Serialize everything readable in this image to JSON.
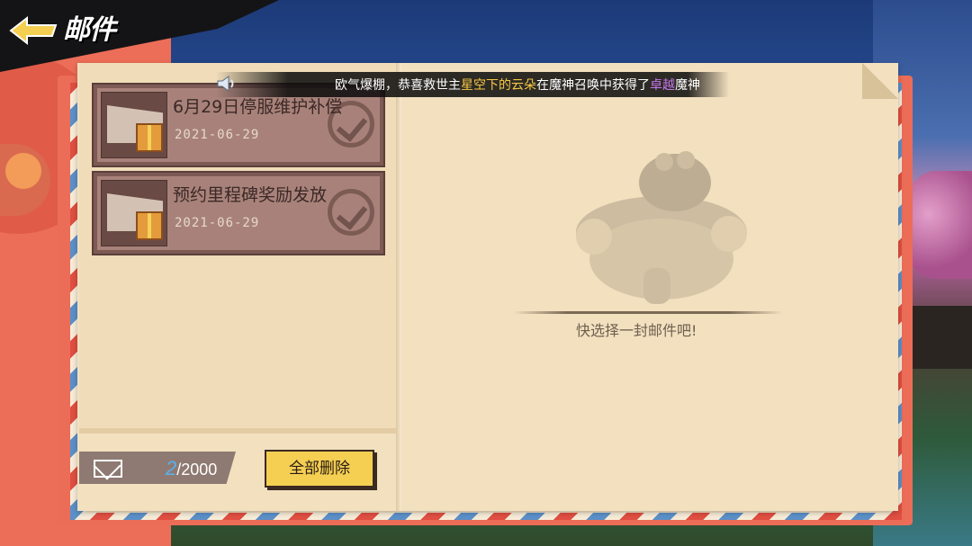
{
  "header": {
    "title": "邮件"
  },
  "announcement": {
    "prefix": "欧气爆棚，恭喜救世主",
    "player": "星空下的云朵",
    "middle": "在魔神召唤中获得了",
    "rarity": "卓越",
    "suffix": "魔神"
  },
  "mails": [
    {
      "title": "6月29日停服维护补偿",
      "date": "2021-06-29"
    },
    {
      "title": "预约里程碑奖励发放",
      "date": "2021-06-29"
    }
  ],
  "mailbox": {
    "count": "2",
    "capacity": "/2000"
  },
  "actions": {
    "delete_all": "全部删除"
  },
  "detail": {
    "empty_hint": "快选择一封邮件吧!"
  },
  "colors": {
    "accent_red": "#ec6d57",
    "button_yellow": "#f4cf52",
    "count_blue": "#5ab0ee",
    "highlight_yellow": "#f7c843",
    "highlight_purple": "#c678ec"
  }
}
